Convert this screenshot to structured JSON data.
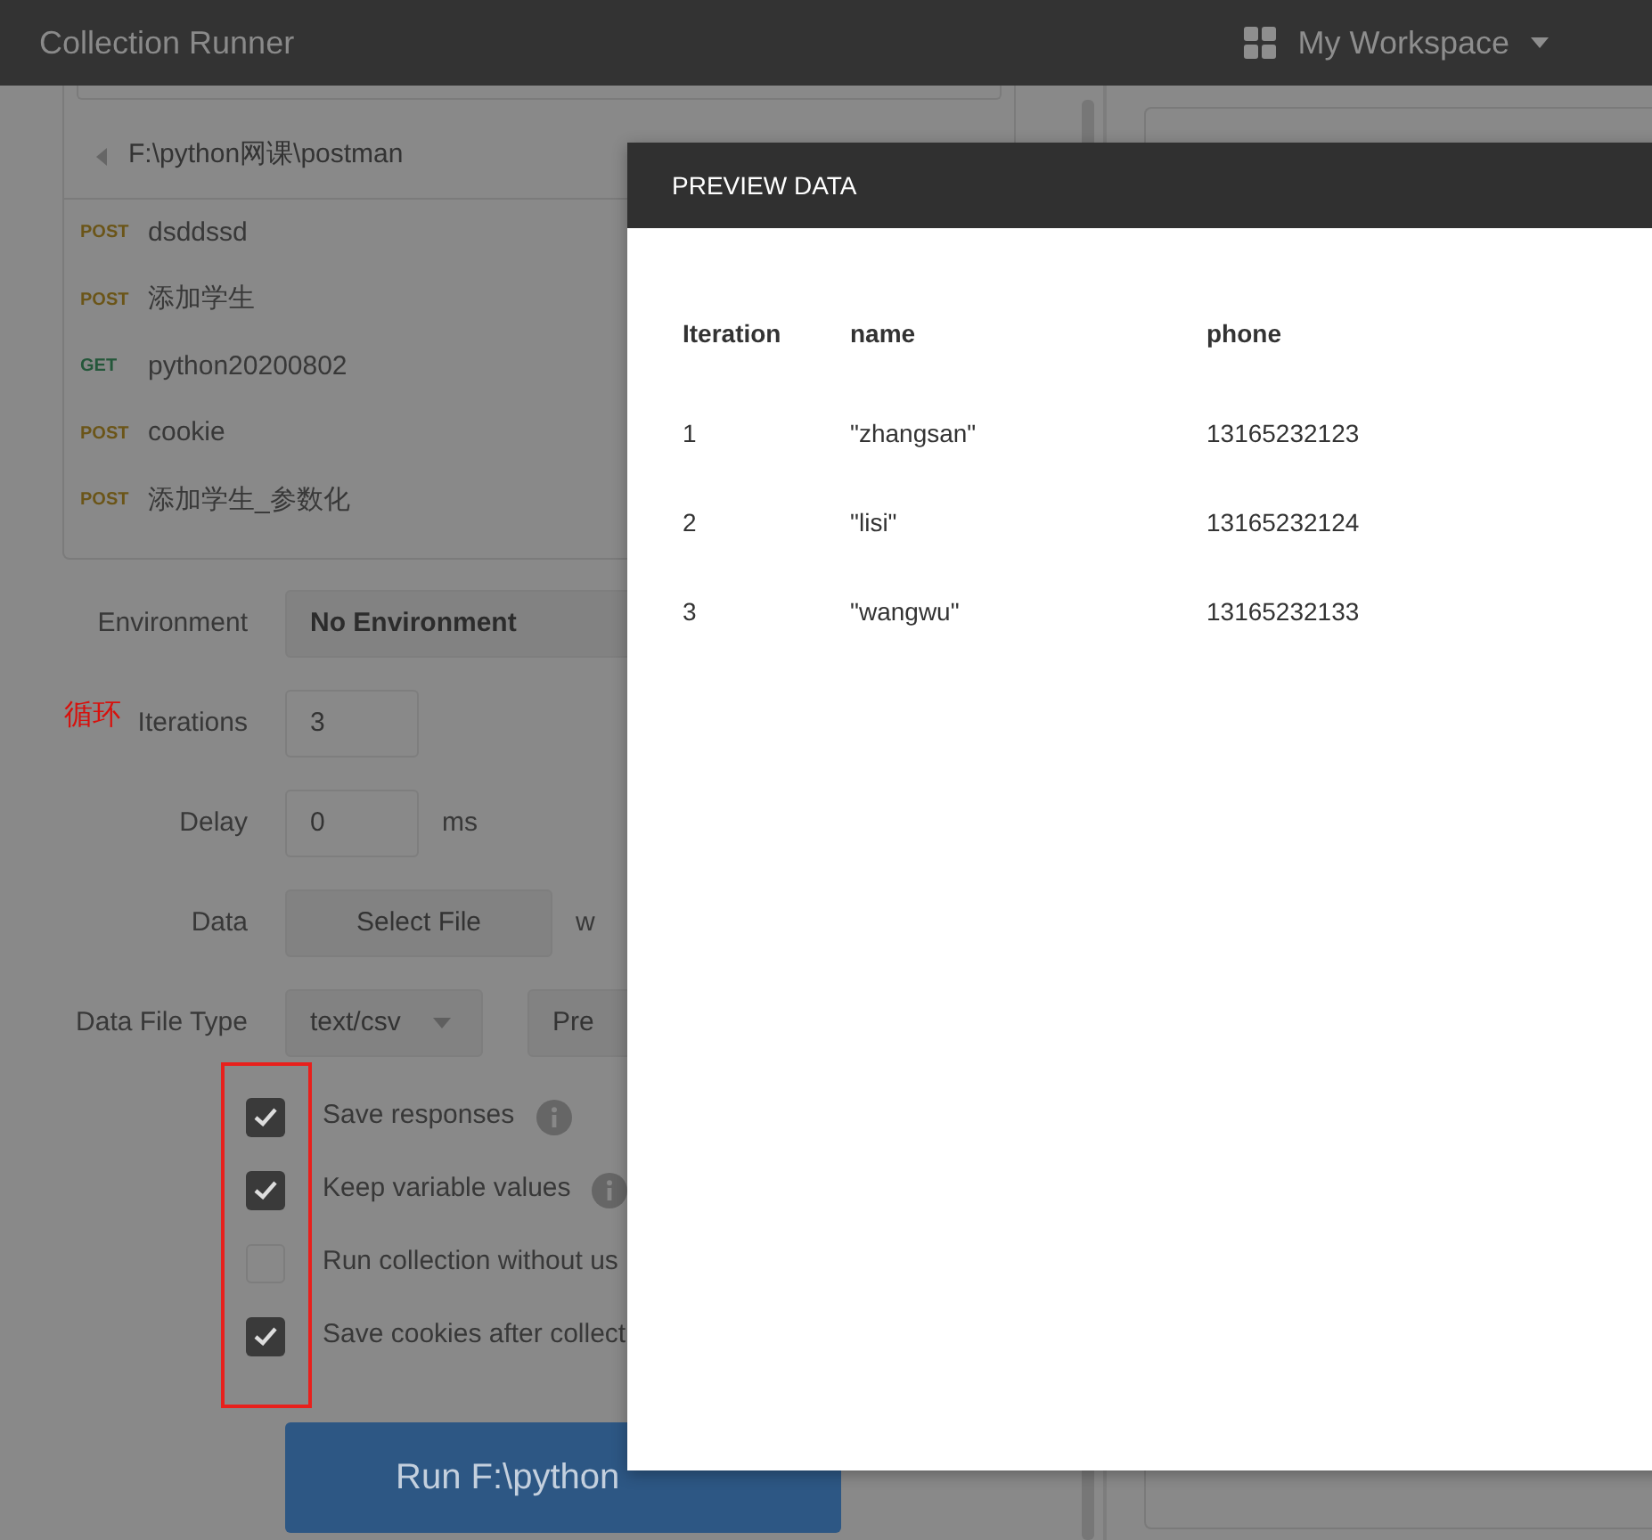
{
  "window": {
    "title": "Collection Runner"
  },
  "workspace": {
    "label": "My Workspace"
  },
  "collection": {
    "folder": "F:\\python网课\\postman",
    "requests": [
      {
        "method": "POST",
        "color": "#6b5518",
        "name": "dsddssd"
      },
      {
        "method": "POST",
        "color": "#6b5518",
        "name": "添加学生"
      },
      {
        "method": "GET",
        "color": "#24573a",
        "name": "python20200802"
      },
      {
        "method": "POST",
        "color": "#6b5518",
        "name": "cookie"
      },
      {
        "method": "POST",
        "color": "#6b5518",
        "name": "添加学生_参数化"
      }
    ]
  },
  "form": {
    "environment": {
      "label": "Environment",
      "value": "No Environment"
    },
    "annotation": "循环",
    "iterations": {
      "label": "Iterations",
      "value": "3"
    },
    "delay": {
      "label": "Delay",
      "value": "0",
      "unit": "ms"
    },
    "data": {
      "label": "Data",
      "button": "Select File",
      "note": "w"
    },
    "data_file_type": {
      "label": "Data File Type",
      "value": "text/csv",
      "preview_button": "Pre"
    }
  },
  "options": [
    {
      "label": "Save responses",
      "checked": true,
      "info": true
    },
    {
      "label": "Keep variable values",
      "checked": true,
      "info": true
    },
    {
      "label": "Run collection without us",
      "checked": false,
      "info": false
    },
    {
      "label": "Save cookies after collect",
      "checked": true,
      "info": false
    }
  ],
  "run_button": "Run F:\\python",
  "preview_dialog": {
    "title": "PREVIEW DATA",
    "columns": [
      "Iteration",
      "name",
      "phone"
    ],
    "rows": [
      [
        "1",
        "\"zhangsan\"",
        "13165232123"
      ],
      [
        "2",
        "\"lisi\"",
        "13165232124"
      ],
      [
        "3",
        "\"wangwu\"",
        "13165232133"
      ]
    ]
  }
}
